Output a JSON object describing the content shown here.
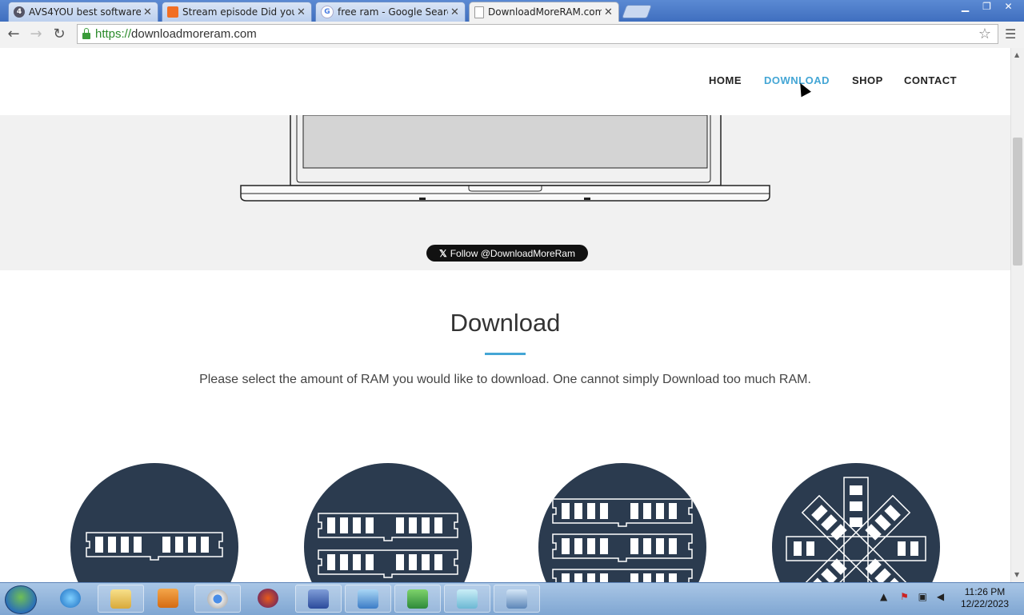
{
  "browser": {
    "tabs": [
      {
        "title": "AVS4YOU best software fo",
        "favicon": "avs-icon",
        "fav_text": "4",
        "color": "#556"
      },
      {
        "title": "Stream episode Did you p",
        "favicon": "soundcloud-icon",
        "fav_text": "",
        "color": "#f26f23"
      },
      {
        "title": "free ram - Google Search",
        "favicon": "google-icon",
        "fav_text": "G",
        "color": "#4a7de2"
      },
      {
        "title": "DownloadMoreRAM.com",
        "favicon": "page-icon",
        "fav_text": "",
        "color": "#ddd"
      }
    ],
    "url_scheme": "https://",
    "url_host": "downloadmoreram.com"
  },
  "site": {
    "nav": [
      "HOME",
      "DOWNLOAD",
      "SHOP",
      "CONTACT"
    ],
    "active_nav": "DOWNLOAD",
    "follow_label": "Follow @DownloadMoreRam",
    "section_title": "Download",
    "subtitle": "Please select the amount of RAM you would like to download. One cannot simply Download too much RAM."
  },
  "taskbar": {
    "time": "11:26 PM",
    "date": "12/22/2023"
  },
  "colors": {
    "accent": "#44a6d5",
    "circle": "#2b3b4f"
  }
}
